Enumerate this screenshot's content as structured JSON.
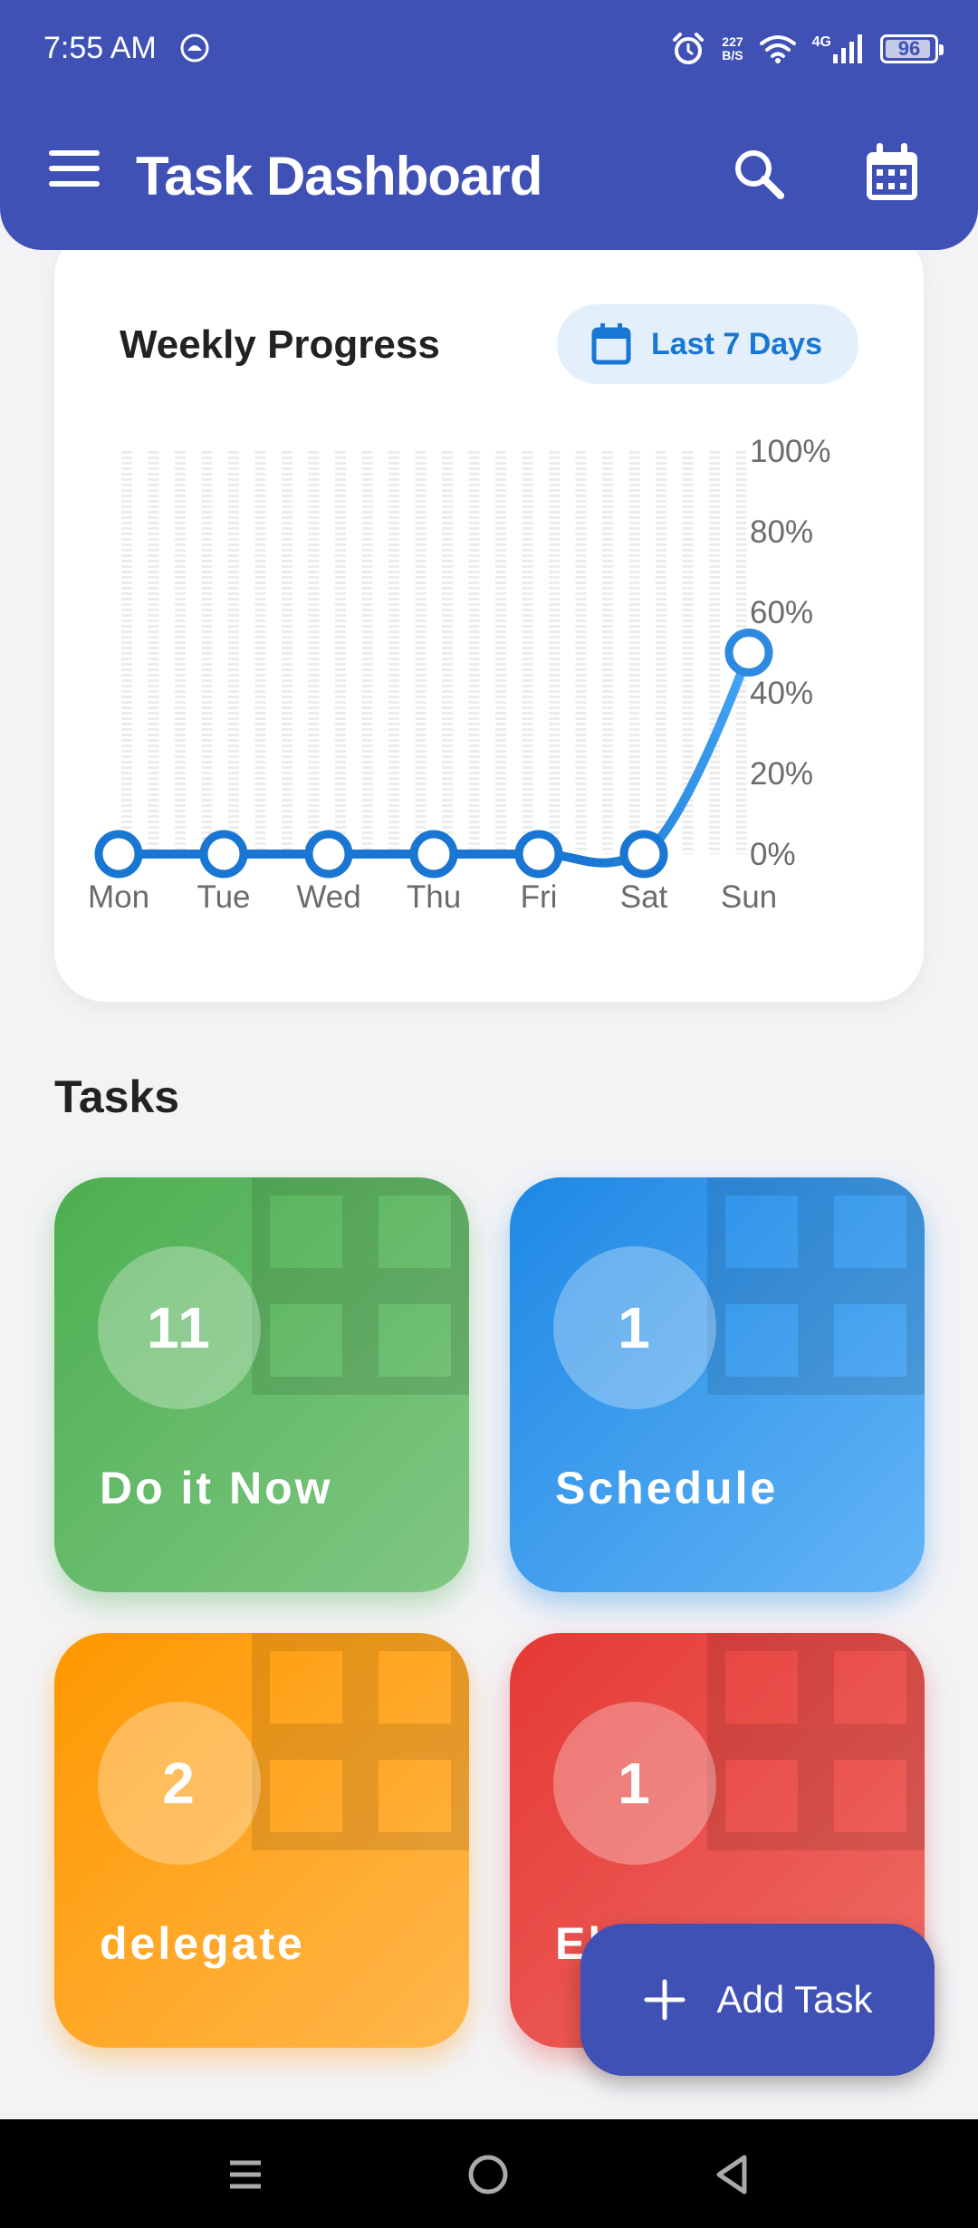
{
  "status_bar": {
    "time": "7:55 AM",
    "net_speed_value": "227",
    "net_speed_unit": "B/S",
    "network": "4G",
    "battery": "96"
  },
  "app_bar": {
    "title": "Task Dashboard",
    "icons": [
      "menu-icon",
      "search-icon",
      "calendar-icon"
    ]
  },
  "weekly_progress": {
    "title": "Weekly Progress",
    "range_label": "Last 7 Days",
    "range_icon": "calendar-icon"
  },
  "chart_data": {
    "type": "line",
    "categories": [
      "Mon",
      "Tue",
      "Wed",
      "Thu",
      "Fri",
      "Sat",
      "Sun"
    ],
    "values": [
      0,
      0,
      0,
      0,
      0,
      0,
      50
    ],
    "y_tick_labels": [
      "0%",
      "20%",
      "40%",
      "60%",
      "80%",
      "100%"
    ],
    "ylim": [
      0,
      100
    ],
    "grid": true,
    "y_axis_position": "right",
    "colors": {
      "line": "#1976d2",
      "line_end": "#42a5f5",
      "point_fill": "#ffffff"
    }
  },
  "tasks": {
    "title": "Tasks",
    "tiles": [
      {
        "count": "11",
        "label": "Do it Now",
        "color": "#4caf50"
      },
      {
        "count": "1",
        "label": "Schedule",
        "color": "#1e88e5"
      },
      {
        "count": "2",
        "label": "delegate",
        "color": "#ff9800"
      },
      {
        "count": "1",
        "label": "El",
        "color": "#e53935"
      }
    ]
  },
  "fab": {
    "label": "Add Task",
    "icon": "plus-icon"
  },
  "nav_bar": {
    "icons": [
      "recents-icon",
      "home-icon",
      "back-icon"
    ]
  },
  "theme": {
    "primary": "#3f51b5"
  }
}
